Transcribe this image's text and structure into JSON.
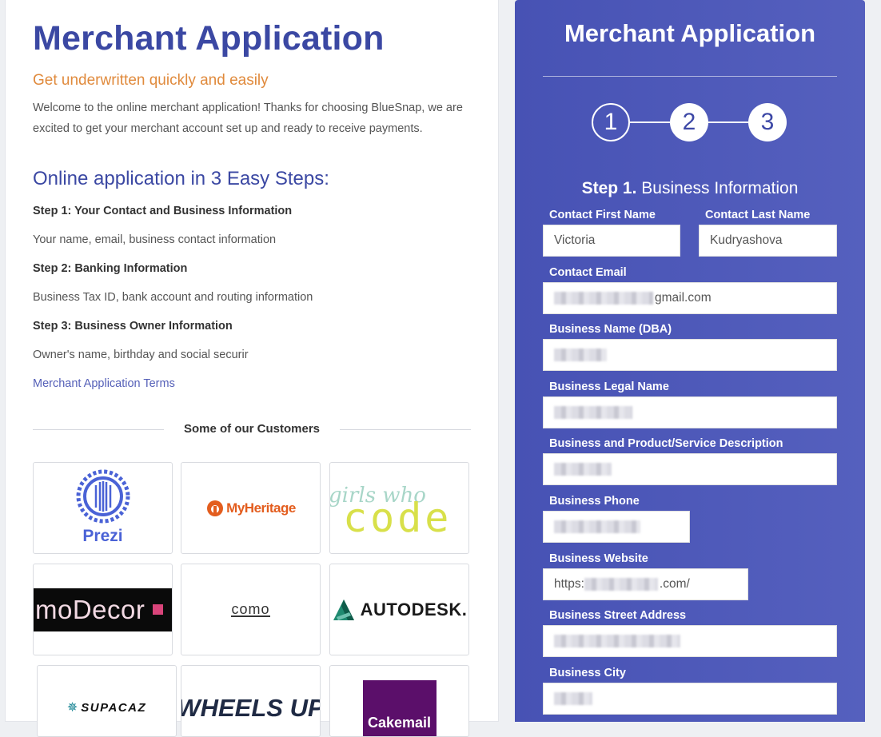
{
  "left": {
    "title": "Merchant Application",
    "subtitle": "Get underwritten quickly and easily",
    "intro": "Welcome to the online merchant application! Thanks for choosing BlueSnap, we are excited to get your merchant account set up and ready to receive payments.",
    "steps_heading": "Online application in 3 Easy Steps:",
    "steps": [
      {
        "title": "Step 1: Your Contact and Business Information",
        "desc": "Your name, email, business contact information"
      },
      {
        "title": "Step 2: Banking Information",
        "desc": "Business Tax ID, bank account and routing information"
      },
      {
        "title": "Step 3: Business Owner Information",
        "desc": "Owner's name, birthday and social securir"
      }
    ],
    "terms_link": "Merchant Application Terms",
    "customers_label": "Some of our Customers",
    "customers": [
      {
        "name": "Prezi"
      },
      {
        "name": "MyHeritage"
      },
      {
        "name_top": "girls who",
        "name_bottom": "code"
      },
      {
        "name": "moDecor"
      },
      {
        "name": "como"
      },
      {
        "name": "AUTODESK."
      },
      {
        "name": "SUPACAZ"
      },
      {
        "name": "WHEELS UP"
      },
      {
        "name": "Cakemail"
      }
    ]
  },
  "form": {
    "title": "Merchant Application",
    "steps": [
      "1",
      "2",
      "3"
    ],
    "step_heading_bold": "Step 1.",
    "step_heading_rest": " Business Information",
    "fields": {
      "first_name": {
        "label": "Contact First Name",
        "value": "Victoria"
      },
      "last_name": {
        "label": "Contact Last Name",
        "value": "Kudryashova"
      },
      "email": {
        "label": "Contact Email",
        "value_visible": "gmail.com"
      },
      "business_name": {
        "label": "Business Name (DBA)"
      },
      "legal_name": {
        "label": "Business Legal Name"
      },
      "description": {
        "label": "Business and Product/Service Description"
      },
      "phone": {
        "label": "Business Phone"
      },
      "website": {
        "label": "Business Website",
        "value_prefix": "https:",
        "value_suffix": ".com/"
      },
      "street": {
        "label": "Business Street Address"
      },
      "city": {
        "label": "Business City"
      }
    }
  },
  "colors": {
    "brand_blue": "#3b48a3",
    "accent_orange": "#e08a3c",
    "panel_blue": "#4f5bb9"
  }
}
